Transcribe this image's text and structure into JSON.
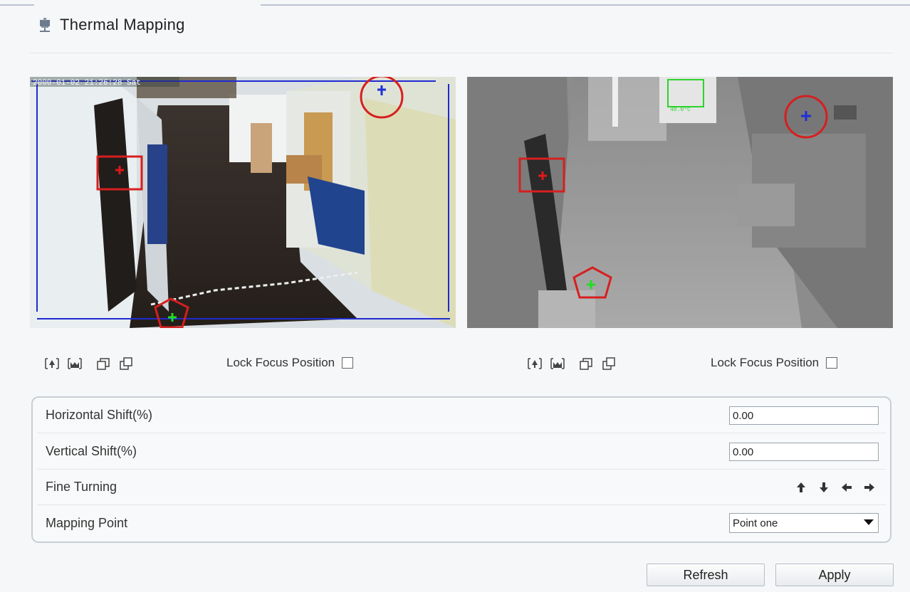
{
  "header": {
    "title": "Thermal Mapping",
    "icon": "thermal-mapping-icon"
  },
  "left_video": {
    "timestamp_text": "2000-01-02 21:26:28 Sat",
    "markers": [
      "blue-cross-marker",
      "red-cross-marker",
      "green-cross-marker"
    ]
  },
  "right_video": {
    "inset_text": "40.0°C"
  },
  "left_controls": {
    "icons": [
      "zoom-in-icon",
      "zoom-out-icon",
      "window-icon",
      "window-copy-icon"
    ],
    "lock_label": "Lock Focus Position",
    "lock_checked": false
  },
  "right_controls": {
    "icons": [
      "zoom-in-icon",
      "zoom-out-icon",
      "window-icon",
      "window-copy-icon"
    ],
    "lock_label": "Lock Focus Position",
    "lock_checked": false
  },
  "settings": {
    "horizontal_shift_label": "Horizontal Shift(%)",
    "horizontal_shift_value": "0.00",
    "vertical_shift_label": "Vertical Shift(%)",
    "vertical_shift_value": "0.00",
    "fine_turning_label": "Fine Turning",
    "fine_turning_icons": [
      "arrow-up-icon",
      "arrow-down-icon",
      "arrow-left-icon",
      "arrow-right-icon"
    ],
    "mapping_point_label": "Mapping Point",
    "mapping_point_value": "Point one"
  },
  "buttons": {
    "refresh": "Refresh",
    "apply": "Apply"
  },
  "colors": {
    "marker_blue": "#1e2fd8",
    "marker_red": "#e01818",
    "marker_green": "#22dd22",
    "highlight_red": "#d61f1f"
  }
}
